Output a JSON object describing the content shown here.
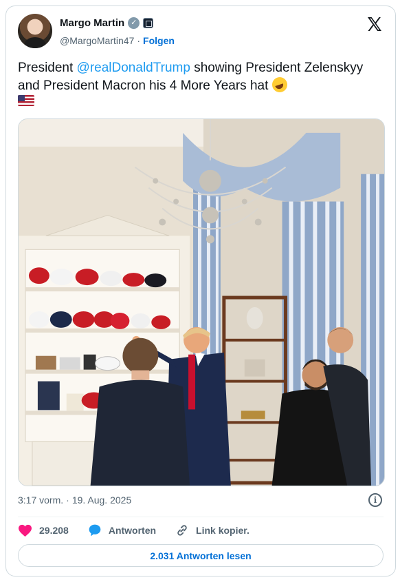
{
  "author": {
    "name": "Margo Martin",
    "handle": "@MargoMartin47",
    "separator": "·",
    "follow_label": "Folgen",
    "verified_badge_color": "#829aab"
  },
  "tweet": {
    "text_before": "President ",
    "mention": "@realDonaldTrump",
    "text_after": " showing President Zelenskyy and President Macron his 4 More Years hat",
    "emojis": [
      "rolling-on-floor-laughing-emoji",
      "us-flag-emoji"
    ]
  },
  "meta": {
    "time": "3:17 vorm.",
    "separator": "·",
    "date": "19. Aug. 2025"
  },
  "actions": {
    "likes": "29.208",
    "reply_label": "Antworten",
    "copy_link_label": "Link kopier."
  },
  "read_replies_label": "2.031 Antworten lesen",
  "colors": {
    "link": "#1d9bf0",
    "follow": "#006fd6",
    "like": "#f91880",
    "reply": "#1d9bf0",
    "secondary_text": "#536471",
    "border": "#cfd9de"
  }
}
